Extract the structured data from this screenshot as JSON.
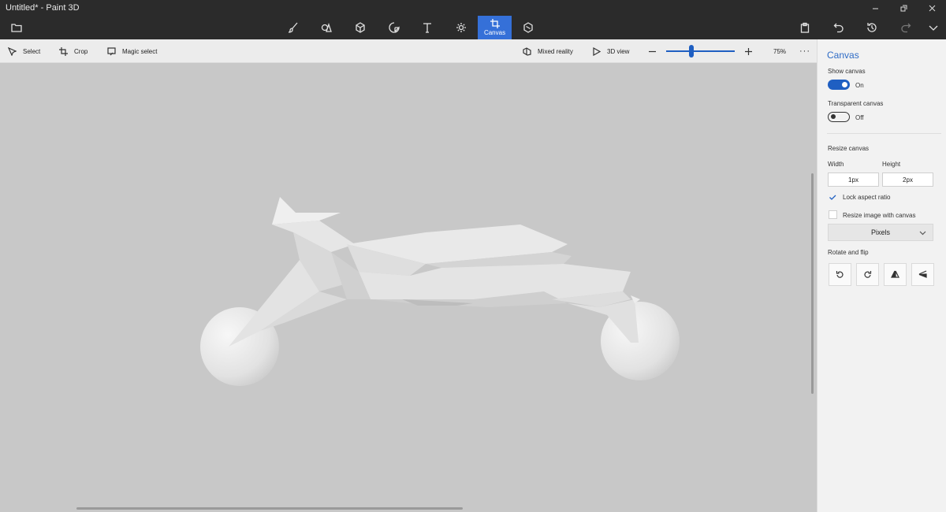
{
  "window": {
    "title": "Untitled* - Paint 3D"
  },
  "main_toolbar": {
    "active_tab_label": "Canvas"
  },
  "sub_toolbar": {
    "select_label": "Select",
    "crop_label": "Crop",
    "magic_select_label": "Magic select",
    "mixed_reality_label": "Mixed reality",
    "view_3d_label": "3D view",
    "zoom_level": "75%",
    "zoom_slider_fraction": 0.37
  },
  "panel": {
    "title": "Canvas",
    "show_canvas": {
      "label": "Show canvas",
      "state": "On"
    },
    "transparent_canvas": {
      "label": "Transparent canvas",
      "state": "Off"
    },
    "resize": {
      "heading": "Resize canvas",
      "width_label": "Width",
      "height_label": "Height",
      "width_value": "1px",
      "height_value": "2px",
      "lock_aspect_label": "Lock aspect ratio",
      "resize_image_label": "Resize image with canvas",
      "units_selected": "Pixels"
    },
    "rotate_flip_heading": "Rotate and flip"
  },
  "colors": {
    "accent": "#1f5fc2",
    "active_tab": "#3570d8",
    "titlebar": "#2b2b2b",
    "workspace": "#c8c8c8",
    "panel_bg": "#f2f2f2"
  }
}
